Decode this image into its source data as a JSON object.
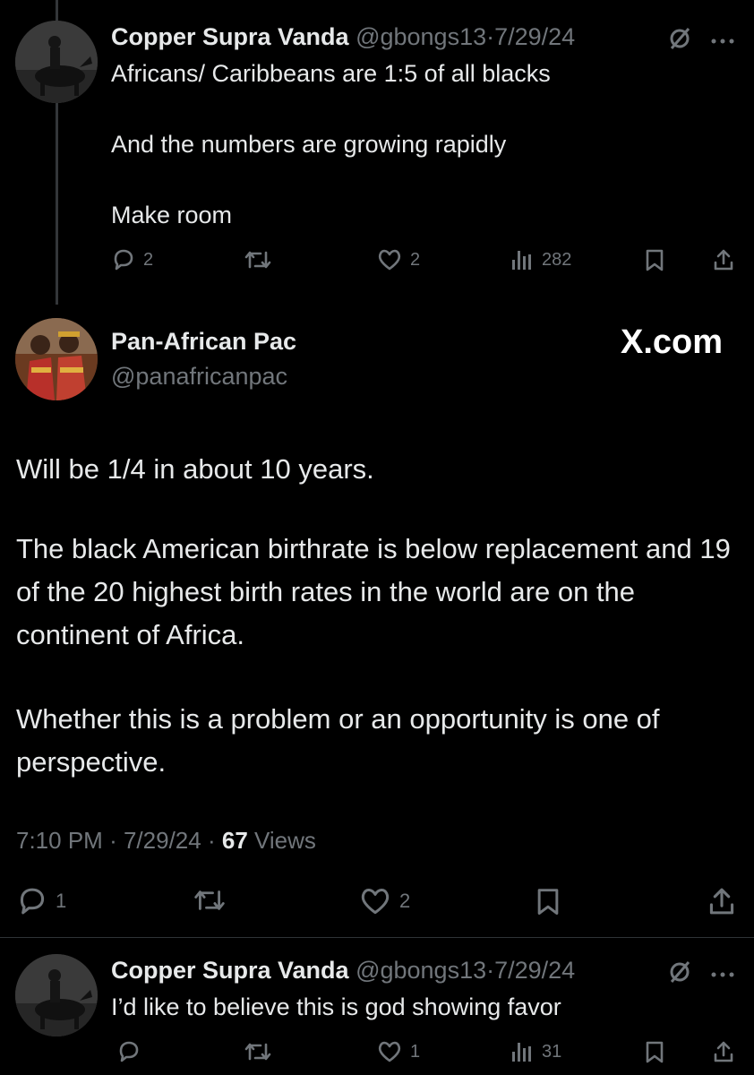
{
  "tweet1": {
    "display_name": "Copper Supra Vanda",
    "handle": "@gbongs13",
    "sep": "·",
    "date": "7/29/24",
    "lines": [
      "Africans/ Caribbeans are 1:5 of all blacks",
      "And the numbers are growing rapidly",
      "Make room"
    ],
    "replies": "2",
    "likes": "2",
    "views": "282"
  },
  "main_post": {
    "display_name": "Pan-African Pac",
    "handle": "@panafricanpac",
    "watermark": "X.com",
    "paragraphs": [
      "Will be 1/4 in about 10 years.",
      "The black American birthrate is below replacement and 19 of the 20 highest birth rates in the world are on the continent of Africa.",
      "Whether this is a problem or an opportunity is one of perspective."
    ],
    "time": "7:10 PM",
    "sep": "·",
    "date": "7/29/24",
    "sep2": "·",
    "views_count": "67",
    "views_label": "Views",
    "replies": "1",
    "likes": "2"
  },
  "tweet3": {
    "display_name": "Copper Supra Vanda",
    "handle": "@gbongs13",
    "sep": "·",
    "date": "7/29/24",
    "text": "I’d like to believe this is god showing favor",
    "likes": "1",
    "views": "31"
  },
  "icons": [
    "muted-circle-icon",
    "more-icon",
    "reply-icon",
    "retweet-icon",
    "heart-icon",
    "views-icon",
    "bookmark-icon",
    "share-icon",
    "x-logo"
  ]
}
